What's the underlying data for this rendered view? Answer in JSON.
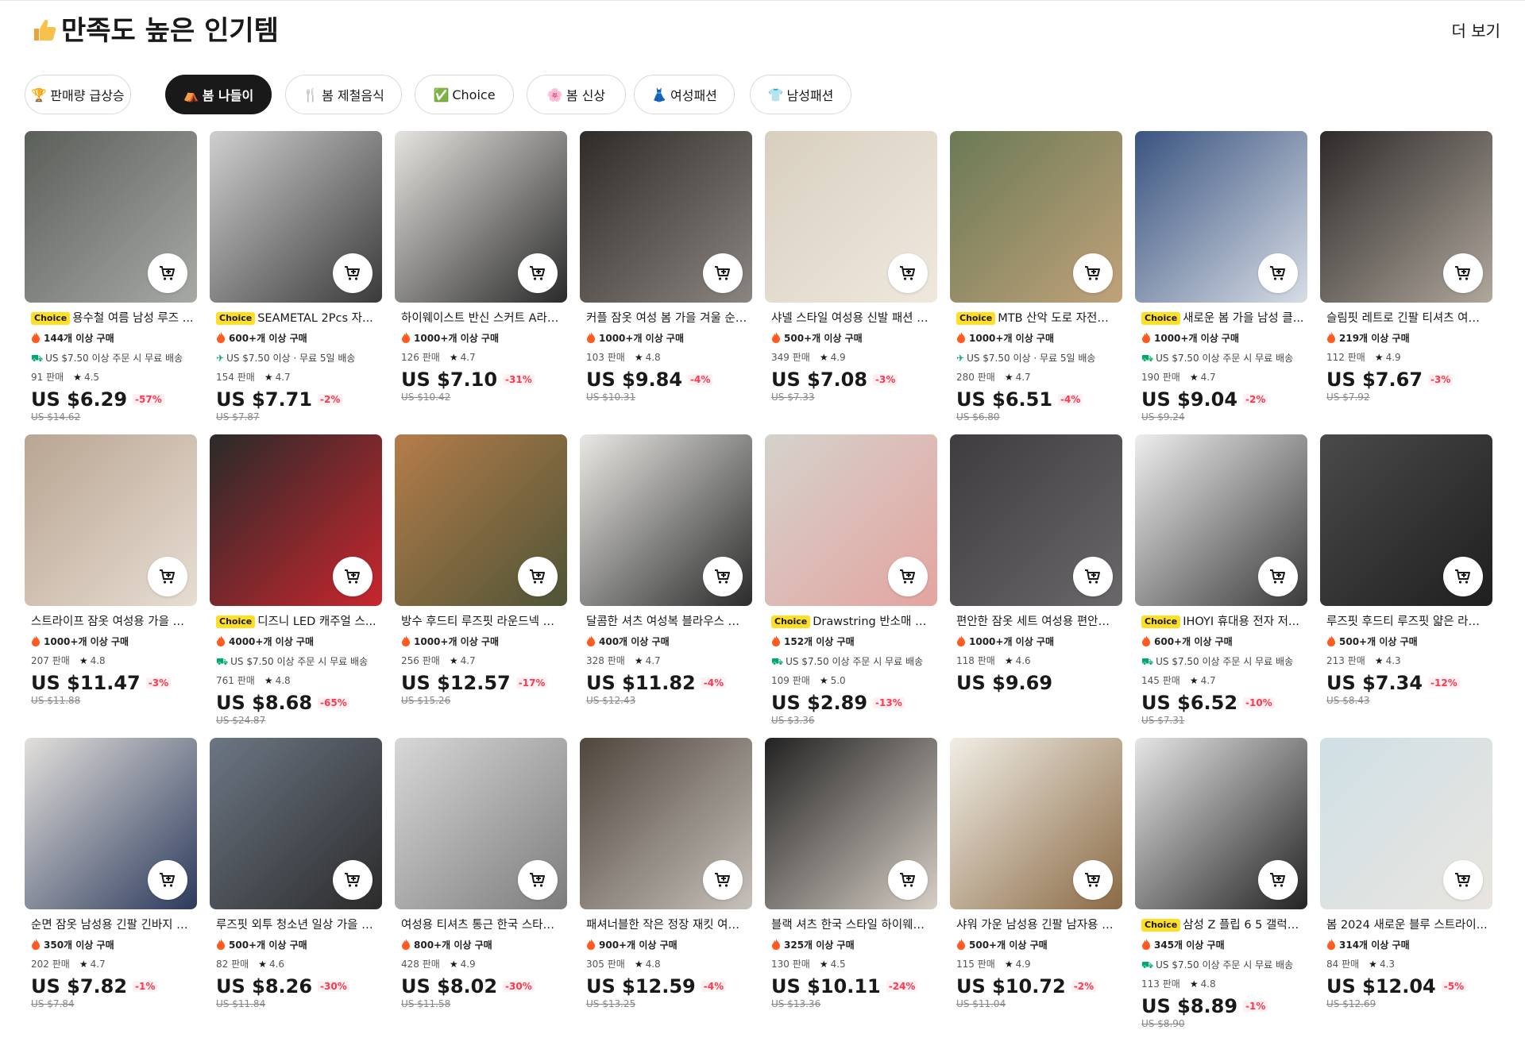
{
  "header": {
    "title": "만족도 높은 인기템",
    "more": "더 보기"
  },
  "tabs": [
    {
      "icon": "🏆",
      "label": "판매량 급상승",
      "active": false
    },
    {
      "icon": "⛺",
      "label": "봄 나들이",
      "active": true
    },
    {
      "icon": "🍴",
      "label": "봄 제철음식",
      "active": false
    },
    {
      "icon": "✅",
      "label": "Choice",
      "active": false
    },
    {
      "icon": "🌸",
      "label": "봄 신상",
      "active": false
    },
    {
      "icon": "👗",
      "label": "여성패션",
      "active": false
    },
    {
      "icon": "👕",
      "label": "남성패션",
      "active": false
    }
  ],
  "colors": {
    "accent": "#fd384f",
    "choice": "#ffdf25",
    "dark": "#191919",
    "ship": "#00a96a"
  },
  "products": [
    {
      "name": "용수철 여름 남성 루즈 ...",
      "choice": true,
      "sold": "144개 이상 구매",
      "ship": "US $7.50 이상 주문 시 무료 배송",
      "ship_icon": "truck-icon",
      "count": "91 판매",
      "rating": "4.5",
      "price": "US $6.29",
      "discount": "-57%",
      "original": "US $14.62"
    },
    {
      "name": "SEAMETAL 2Pcs 자...",
      "choice": true,
      "sold": "600+개 이상 구매",
      "ship": "US $7.50 이상 · 무료 5일 배송",
      "ship_icon": "plane-icon",
      "count": "154 판매",
      "rating": "4.7",
      "price": "US $7.71",
      "discount": "-2%",
      "original": "US $7.87"
    },
    {
      "name": "하이웨이스트 반신 스커트 A라인...",
      "choice": false,
      "sold": "1000+개 이상 구매",
      "ship": "",
      "count": "126 판매",
      "rating": "4.7",
      "price": "US $7.10",
      "discount": "-31%",
      "original": "US $10.42"
    },
    {
      "name": "커플 잠옷 여성 봄 가을 겨울 순수...",
      "choice": false,
      "sold": "1000+개 이상 구매",
      "ship": "",
      "count": "103 판매",
      "rating": "4.8",
      "price": "US $9.84",
      "discount": "-4%",
      "original": "US $10.31"
    },
    {
      "name": "샤넬 스타일 여성용 신발 패션 플...",
      "choice": false,
      "sold": "500+개 이상 구매",
      "ship": "",
      "count": "349 판매",
      "rating": "4.9",
      "price": "US $7.08",
      "discount": "-3%",
      "original": "US $7.33"
    },
    {
      "name": "MTB 산악 도로 자전거 ...",
      "choice": true,
      "sold": "1000+개 이상 구매",
      "ship": "US $7.50 이상 · 무료 5일 배송",
      "ship_icon": "plane-icon",
      "count": "280 판매",
      "rating": "4.7",
      "price": "US $6.51",
      "discount": "-4%",
      "original": "US $6.80"
    },
    {
      "name": "새로운 봄 가을 남성 클...",
      "choice": true,
      "sold": "1000+개 이상 구매",
      "ship": "US $7.50 이상 주문 시 무료 배송",
      "ship_icon": "truck-icon",
      "count": "190 판매",
      "rating": "4.7",
      "price": "US $9.04",
      "discount": "-2%",
      "original": "US $9.24"
    },
    {
      "name": "슬림핏 레트로 긴팔 티셔츠 여성...",
      "choice": false,
      "sold": "219개 이상 구매",
      "ship": "",
      "count": "112 판매",
      "rating": "4.9",
      "price": "US $7.67",
      "discount": "-3%",
      "original": "US $7.92"
    },
    {
      "name": "스트라이프 잠옷 여성용 가을 스...",
      "choice": false,
      "sold": "1000+개 이상 구매",
      "ship": "",
      "count": "207 판매",
      "rating": "4.8",
      "price": "US $11.47",
      "discount": "-3%",
      "original": "US $11.88"
    },
    {
      "name": "디즈니 LED 캐주얼 스...",
      "choice": true,
      "sold": "4000+개 이상 구매",
      "ship": "US $7.50 이상 주문 시 무료 배송",
      "ship_icon": "truck-icon",
      "count": "761 판매",
      "rating": "4.8",
      "price": "US $8.68",
      "discount": "-65%",
      "original": "US $24.87"
    },
    {
      "name": "방수 후드티 루즈핏 라운드넥 캐...",
      "choice": false,
      "sold": "1000+개 이상 구매",
      "ship": "",
      "count": "256 판매",
      "rating": "4.7",
      "price": "US $12.57",
      "discount": "-17%",
      "original": "US $15.26"
    },
    {
      "name": "달콤한 셔츠 여성복 블라우스 달...",
      "choice": false,
      "sold": "400개 이상 구매",
      "ship": "",
      "count": "328 판매",
      "rating": "4.7",
      "price": "US $11.82",
      "discount": "-4%",
      "original": "US $12.43"
    },
    {
      "name": "Drawstring 반소매 티...",
      "choice": true,
      "sold": "152개 이상 구매",
      "ship": "US $7.50 이상 주문 시 무료 배송",
      "ship_icon": "truck-icon",
      "count": "109 판매",
      "rating": "5.0",
      "price": "US $2.89",
      "discount": "-13%",
      "original": "US $3.36"
    },
    {
      "name": "편안한 잠옷 세트 여성용 편안한 ...",
      "choice": false,
      "sold": "1000+개 이상 구매",
      "ship": "",
      "count": "118 판매",
      "rating": "4.6",
      "price": "US $9.69",
      "discount": "",
      "original": ""
    },
    {
      "name": "IHOYI 휴대용 전자 저...",
      "choice": true,
      "sold": "600+개 이상 구매",
      "ship": "US $7.50 이상 주문 시 무료 배송",
      "ship_icon": "truck-icon",
      "count": "145 판매",
      "rating": "4.7",
      "price": "US $6.52",
      "discount": "-10%",
      "original": "US $7.31"
    },
    {
      "name": "루즈핏 후드티 루즈핏 얇은 라운...",
      "choice": false,
      "sold": "500+개 이상 구매",
      "ship": "",
      "count": "213 판매",
      "rating": "4.3",
      "price": "US $7.34",
      "discount": "-12%",
      "original": "US $8.43"
    },
    {
      "name": "순면 잠옷 남성용 긴팔 긴바지 2...",
      "choice": false,
      "sold": "350개 이상 구매",
      "ship": "",
      "count": "202 판매",
      "rating": "4.7",
      "price": "US $7.82",
      "discount": "-1%",
      "original": "US $7.84"
    },
    {
      "name": "루즈핏 외투 청소년 일상 가을 루...",
      "choice": false,
      "sold": "500+개 이상 구매",
      "ship": "",
      "count": "82 판매",
      "rating": "4.6",
      "price": "US $8.26",
      "discount": "-30%",
      "original": "US $11.84"
    },
    {
      "name": "여성용 티셔츠 통근 한국 스타일 ...",
      "choice": false,
      "sold": "800+개 이상 구매",
      "ship": "",
      "count": "428 판매",
      "rating": "4.9",
      "price": "US $8.02",
      "discount": "-30%",
      "original": "US $11.58"
    },
    {
      "name": "패셔너블한 작은 정장 재킷 여성...",
      "choice": false,
      "sold": "900+개 이상 구매",
      "ship": "",
      "count": "305 판매",
      "rating": "4.8",
      "price": "US $12.59",
      "discount": "-4%",
      "original": "US $13.25"
    },
    {
      "name": "블랙 셔츠 한국 스타일 하이웨이...",
      "choice": false,
      "sold": "325개 이상 구매",
      "ship": "",
      "count": "130 판매",
      "rating": "4.5",
      "price": "US $10.11",
      "discount": "-24%",
      "original": "US $13.36"
    },
    {
      "name": "샤워 가운 남성용 긴팔 남자용 남...",
      "choice": false,
      "sold": "500+개 이상 구매",
      "ship": "",
      "count": "115 판매",
      "rating": "4.9",
      "price": "US $10.72",
      "discount": "-2%",
      "original": "US $11.04"
    },
    {
      "name": "삼성 Z 플립 6 5 갤럭시...",
      "choice": true,
      "sold": "345개 이상 구매",
      "ship": "US $7.50 이상 주문 시 무료 배송",
      "ship_icon": "truck-icon",
      "count": "113 판매",
      "rating": "4.8",
      "price": "US $8.89",
      "discount": "-1%",
      "original": "US $8.90"
    },
    {
      "name": "봄 2024 새로운 블루 스트라이...",
      "choice": false,
      "sold": "314개 이상 구매",
      "ship": "",
      "count": "84 판매",
      "rating": "4.3",
      "price": "US $12.04",
      "discount": "-5%",
      "original": "US $12.69"
    }
  ]
}
